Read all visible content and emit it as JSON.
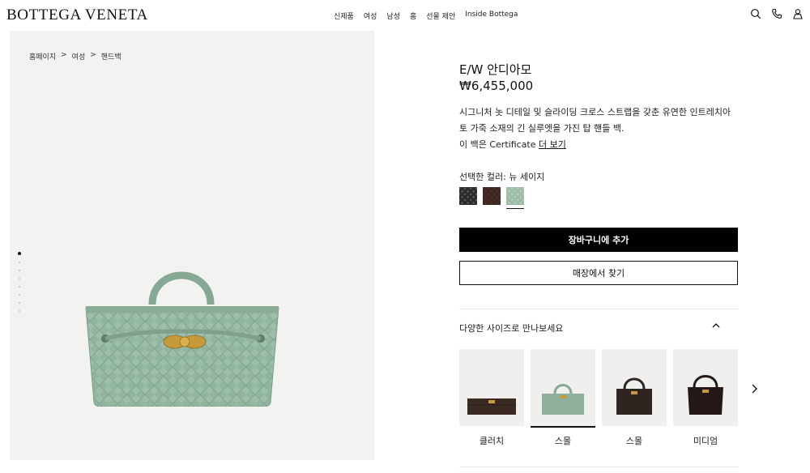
{
  "header": {
    "brand": "BOTTEGA VENETA",
    "nav": [
      "신제품",
      "여성",
      "남성",
      "홈",
      "선물 제안",
      "Inside Bottega"
    ],
    "icons": [
      "search-icon",
      "phone-icon",
      "account-icon"
    ]
  },
  "breadcrumb": [
    "홈페이지",
    ">",
    "여성",
    ">",
    "핸드백"
  ],
  "gallery": {
    "image_count": 8,
    "active_index": 0
  },
  "product": {
    "title": "E/W 안디아모",
    "price": "₩6,455,000",
    "description": "시그니처 놋 디테일 및 슬라이딩 크로스 스트랩을 갖춘 유연한 인트레치아토 가죽 소재의 긴 실루엣을 가진 탑 핸들 백.",
    "cert_prefix": "이 백은 Certificate",
    "cert_link": "더 보기",
    "color_label": "선택한 컬러: 뉴 세이지",
    "swatches": [
      {
        "name": "black",
        "color": "#2a2a2a"
      },
      {
        "name": "fondant",
        "color": "#3d2520"
      },
      {
        "name": "new-sage",
        "color": "#9dbba6",
        "selected": true
      }
    ]
  },
  "actions": {
    "add_to_cart": "장바구니에 추가",
    "find_in_store": "매장에서 찾기"
  },
  "sizes": {
    "heading": "다양한 사이즈로 만나보세요",
    "items": [
      {
        "label": "클러치",
        "color": "#3b2a22"
      },
      {
        "label": "스몰",
        "color": "#8fb09a",
        "selected": true
      },
      {
        "label": "스몰",
        "color": "#2e2521"
      },
      {
        "label": "미디엄",
        "color": "#231816"
      }
    ]
  },
  "colors": {
    "bag": "#92b5a0",
    "hardware": "#c59a3a",
    "panel_bg": "#f2f2f1"
  }
}
